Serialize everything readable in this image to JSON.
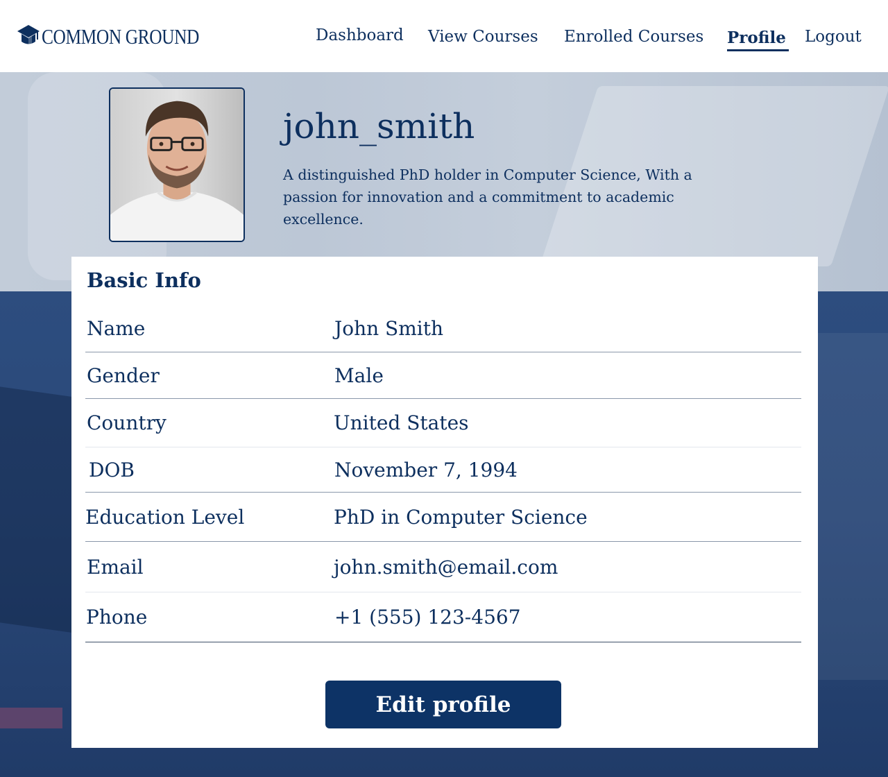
{
  "brand": {
    "name": "COMMON GROUND",
    "icon": "graduation-cap-icon"
  },
  "nav": {
    "items": [
      {
        "label": "Dashboard",
        "active": false
      },
      {
        "label": "View Courses",
        "active": false
      },
      {
        "label": "Enrolled Courses",
        "active": false
      },
      {
        "label": "Profile",
        "active": true
      },
      {
        "label": "Logout",
        "active": false
      }
    ]
  },
  "profile": {
    "username": "john_smith",
    "bio": "A distinguished PhD holder in Computer Science, With a passion for innovation and a commitment to academic excellence."
  },
  "basic_info": {
    "title": "Basic Info",
    "rows": [
      {
        "label": "Name",
        "value": "John Smith"
      },
      {
        "label": "Gender",
        "value": "Male"
      },
      {
        "label": "Country",
        "value": "United States"
      },
      {
        "label": "DOB",
        "value": "November 7, 1994"
      },
      {
        "label": "Education Level",
        "value": "PhD in Computer Science"
      },
      {
        "label": "Email",
        "value": "john.smith@email.com"
      },
      {
        "label": "Phone",
        "value": "+1 (555) 123-4567"
      }
    ]
  },
  "actions": {
    "edit_label": "Edit profile"
  },
  "colors": {
    "primary": "#0d2f5e",
    "button": "#0d3366",
    "background_dark": "#2a4878"
  }
}
